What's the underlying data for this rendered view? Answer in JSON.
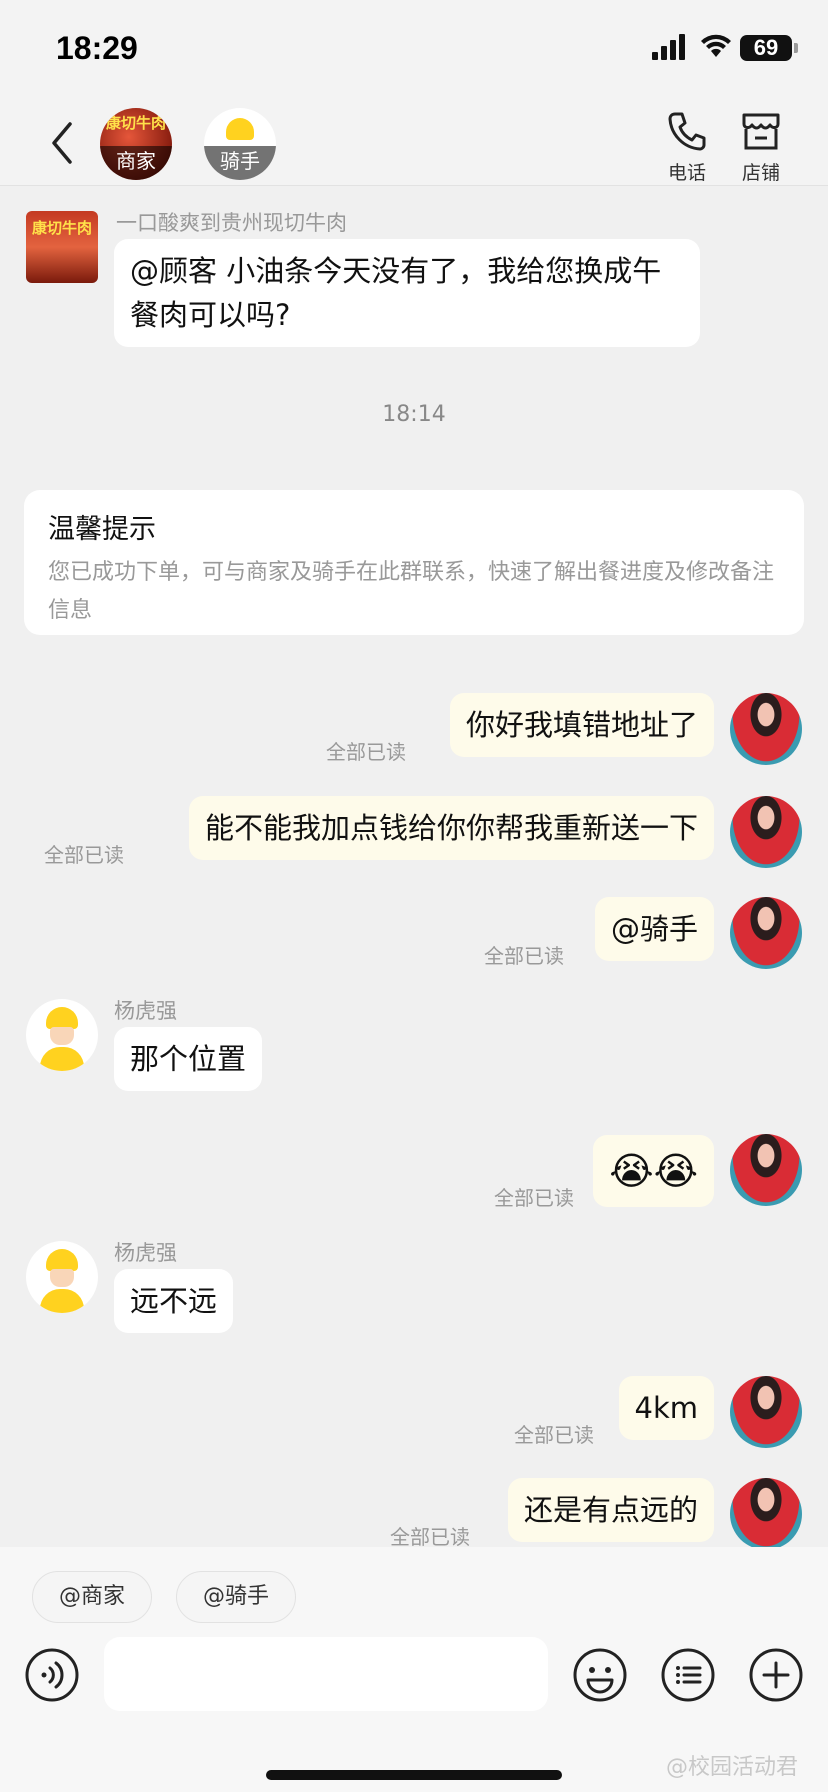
{
  "status_bar": {
    "time": "18:29",
    "battery": "69"
  },
  "header": {
    "merchant_tag": "商家",
    "merchant_avatar_text": "康切牛肉",
    "rider_tag": "骑手",
    "phone_label": "电话",
    "shop_label": "店铺"
  },
  "chat": {
    "merchant_name": "一口酸爽到贵州现切牛肉",
    "merchant_avatar_text": "康切牛肉",
    "merchant_message": "@顾客 小油条今天没有了，我给您换成午餐肉可以吗?",
    "time_divider": "18:14",
    "notice": {
      "title": "温馨提示",
      "body": "您已成功下单，可与商家及骑手在此群联系，快速了解出餐进度及修改备注信息"
    },
    "read_label": "全部已读",
    "messages": [
      {
        "text": "你好我填错地址了"
      },
      {
        "text": "能不能我加点钱给你你帮我重新送一下"
      },
      {
        "text": "@骑手"
      },
      {
        "sender": "杨虎强",
        "text": "那个位置"
      },
      {
        "text": "😭😭"
      },
      {
        "sender": "杨虎强",
        "text": "远不远"
      },
      {
        "text": "4km"
      },
      {
        "text": "还是有点远的"
      }
    ]
  },
  "bottom": {
    "mention_merchant": "@商家",
    "mention_rider": "@骑手",
    "input_value": "",
    "watermark": "@校园活动君"
  }
}
